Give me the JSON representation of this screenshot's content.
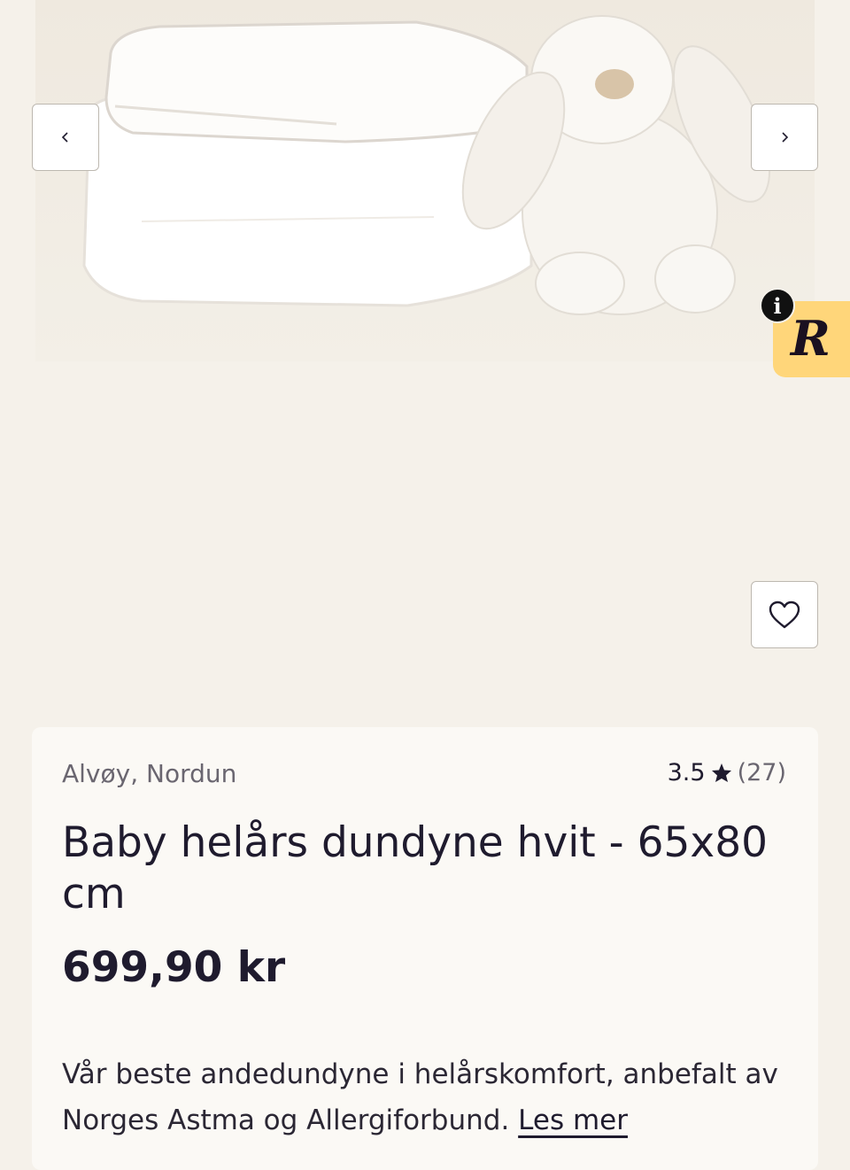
{
  "product": {
    "brand": "Alvøy, Nordun",
    "rating": "3.5",
    "rating_count": "(27)",
    "title": "Baby helårs dundyne hvit - 65x80 cm",
    "price": "699,90 kr",
    "description": "Vår beste andedundyne i helårskomfort, anbefalt av Norges Astma og Allergiforbund.",
    "read_more": "Les mer"
  },
  "badge": {
    "letter": "R",
    "info": "i"
  },
  "icons": [
    "chevron-left-icon",
    "chevron-right-icon",
    "heart-icon",
    "star-icon",
    "info-icon"
  ]
}
